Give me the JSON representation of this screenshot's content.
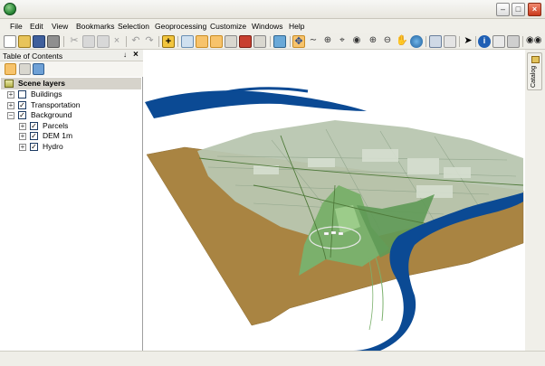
{
  "window": {
    "title": ""
  },
  "menu": [
    "File",
    "Edit",
    "View",
    "Bookmarks",
    "Selection",
    "Geoprocessing",
    "Customize",
    "Windows",
    "Help"
  ],
  "toc": {
    "title": "Table of Contents",
    "pin": "↓",
    "close": "×",
    "root": "Scene layers",
    "layers": [
      {
        "label": "Buildings",
        "checked": false,
        "expander": "+"
      },
      {
        "label": "Transportation",
        "checked": true,
        "expander": "+"
      },
      {
        "label": "Background",
        "checked": true,
        "expander": "−"
      },
      {
        "label": "Parcels",
        "checked": true,
        "expander": "+"
      },
      {
        "label": "DEM 1m",
        "checked": true,
        "expander": "+"
      },
      {
        "label": "Hydro",
        "checked": true,
        "expander": "+"
      }
    ]
  },
  "catalog": {
    "label": "Catalog"
  },
  "colors": {
    "terrain": "#a98442",
    "water": "#0b4a94",
    "parcels": "#7bb06c",
    "urban": "#b8c6b0"
  }
}
